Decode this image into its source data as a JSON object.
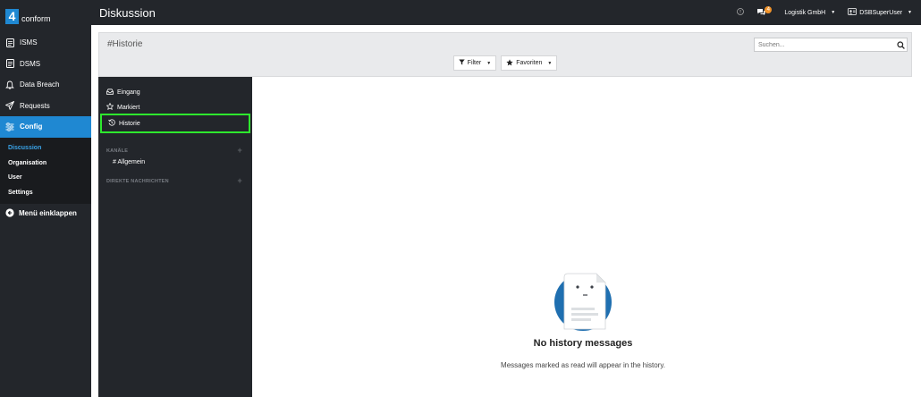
{
  "app": {
    "logo_mark": "4",
    "logo_text": "conform",
    "page_title": "Diskussion",
    "accent_color": "#1f88d2",
    "badge_color": "#f0932b"
  },
  "topbar": {
    "help_icon": "question-circle-icon",
    "chat_badge": "4",
    "company": "Logistik GmbH",
    "user": "DSBSuperUser"
  },
  "sidebar": {
    "items": [
      {
        "label": "ISMS",
        "icon": "document-icon"
      },
      {
        "label": "DSMS",
        "icon": "document-icon"
      },
      {
        "label": "Data Breach",
        "icon": "bell-icon"
      },
      {
        "label": "Requests",
        "icon": "paper-plane-icon"
      },
      {
        "label": "Config",
        "icon": "sliders-icon"
      }
    ],
    "sub_items": [
      {
        "label": "Discussion"
      },
      {
        "label": "Organisation"
      },
      {
        "label": "User"
      },
      {
        "label": "Settings"
      }
    ],
    "collapse_label": "Menü einklappen"
  },
  "header": {
    "channel_title": "#Historie",
    "search_placeholder": "Suchen...",
    "filter_label": "Filter",
    "favorites_label": "Favoriten"
  },
  "channels": {
    "items": [
      {
        "label": "Eingang",
        "icon": "inbox-icon"
      },
      {
        "label": "Markiert",
        "icon": "star-icon"
      },
      {
        "label": "Historie",
        "icon": "history-icon"
      }
    ],
    "section_channels": "KANÄLE",
    "channel_general": "# Allgemein",
    "section_direct": "DIREKTE NACHRICHTEN"
  },
  "empty_state": {
    "title": "No history messages",
    "subtitle": "Messages marked as read will appear in the history."
  }
}
